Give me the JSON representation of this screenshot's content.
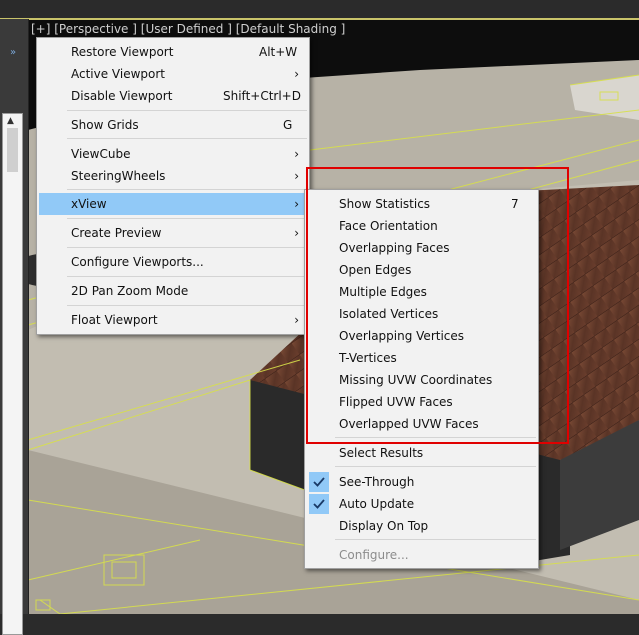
{
  "viewport": {
    "label_parts": [
      "[+]",
      "[Perspective ]",
      "[User Defined ]",
      "[Default Shading ]"
    ]
  },
  "main_menu": {
    "items": [
      {
        "label": "Restore Viewport",
        "shortcut": "Alt+W"
      },
      {
        "label": "Active Viewport",
        "submenu": true
      },
      {
        "label": "Disable Viewport",
        "shortcut": "Shift+Ctrl+D"
      },
      {
        "label": "Show Grids",
        "shortcut": "G"
      },
      {
        "label": "ViewCube",
        "submenu": true
      },
      {
        "label": "SteeringWheels",
        "submenu": true
      },
      {
        "label": "xView",
        "submenu": true,
        "highlighted": true
      },
      {
        "label": "Create Preview",
        "submenu": true
      },
      {
        "label": "Configure Viewports..."
      },
      {
        "label": "2D Pan Zoom Mode"
      },
      {
        "label": "Float Viewport",
        "submenu": true
      }
    ]
  },
  "xview_menu": {
    "items": [
      {
        "label": "Show Statistics",
        "shortcut": "7"
      },
      {
        "label": "Face Orientation"
      },
      {
        "label": "Overlapping Faces"
      },
      {
        "label": "Open Edges"
      },
      {
        "label": "Multiple Edges"
      },
      {
        "label": "Isolated Vertices"
      },
      {
        "label": "Overlapping Vertices"
      },
      {
        "label": "T-Vertices"
      },
      {
        "label": "Missing UVW Coordinates"
      },
      {
        "label": "Flipped UVW Faces"
      },
      {
        "label": "Overlapped UVW Faces"
      },
      {
        "label": "Select Results"
      },
      {
        "label": "See-Through",
        "checked": true
      },
      {
        "label": "Auto Update",
        "checked": true
      },
      {
        "label": "Display On Top"
      },
      {
        "label": "Configure...",
        "disabled": true
      }
    ]
  },
  "colors": {
    "highlight": "#91c9f7",
    "annotation_box": "#e00000",
    "viewport_border": "#c9c36a",
    "wireframe": "#d8e04a"
  }
}
